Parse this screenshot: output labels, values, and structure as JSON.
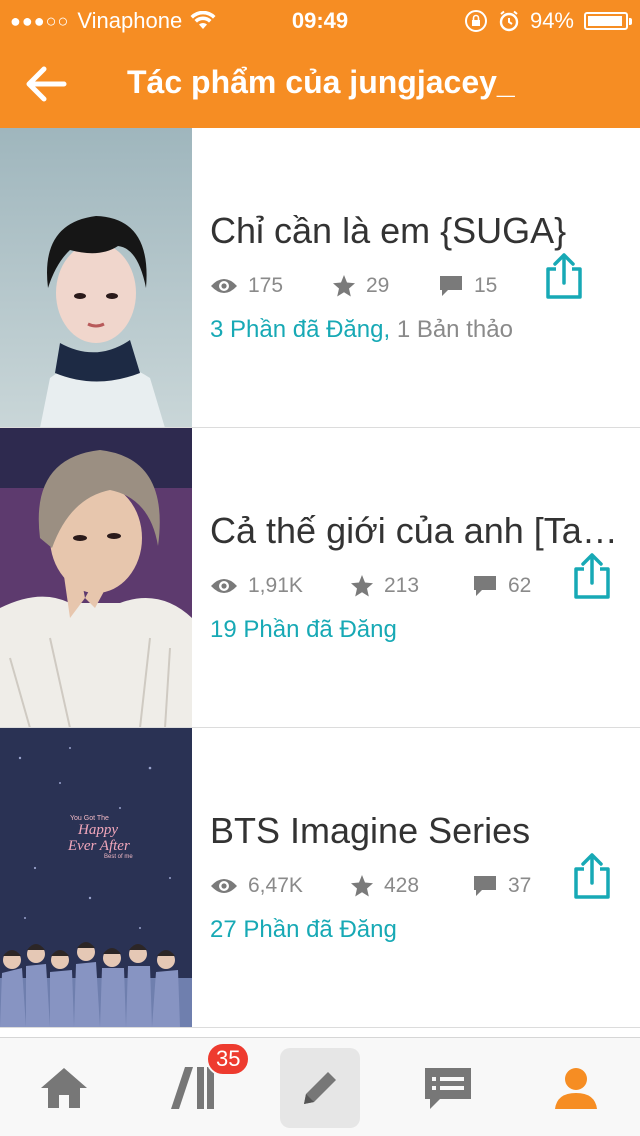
{
  "status_bar": {
    "signal_dots": "●●●○○",
    "carrier": "Vinaphone",
    "time": "09:49",
    "battery_percent": "94%",
    "battery_level": 0.94
  },
  "header": {
    "title": "Tác phẩm của jungjacey_",
    "background_color": "#f68d23"
  },
  "stories": [
    {
      "title": "Chỉ cần là em {SUGA}",
      "views": "175",
      "votes": "29",
      "comments": "15",
      "published": "3 Phần đã Đăng,",
      "drafts": "1 Bản thảo"
    },
    {
      "title": "Cả thế giới của anh [Taehyung]",
      "views": "1,91K",
      "votes": "213",
      "comments": "62",
      "published": "19 Phần đã Đăng",
      "drafts": ""
    },
    {
      "title": "BTS Imagine Series",
      "views": "6,47K",
      "votes": "428",
      "comments": "37",
      "published": "27 Phần đã Đăng",
      "drafts": "",
      "cover_text": [
        "You Got The",
        "Happy",
        "Ever After",
        "Best of me"
      ]
    }
  ],
  "tabbar": {
    "library_badge": "35",
    "tabs": [
      "home-icon",
      "library-icon",
      "write-icon",
      "messages-icon",
      "profile-icon"
    ],
    "active_color": "#f68d23"
  },
  "colors": {
    "accent": "#f68d23",
    "teal": "#17a9b5",
    "badge": "#ee3b2f"
  }
}
